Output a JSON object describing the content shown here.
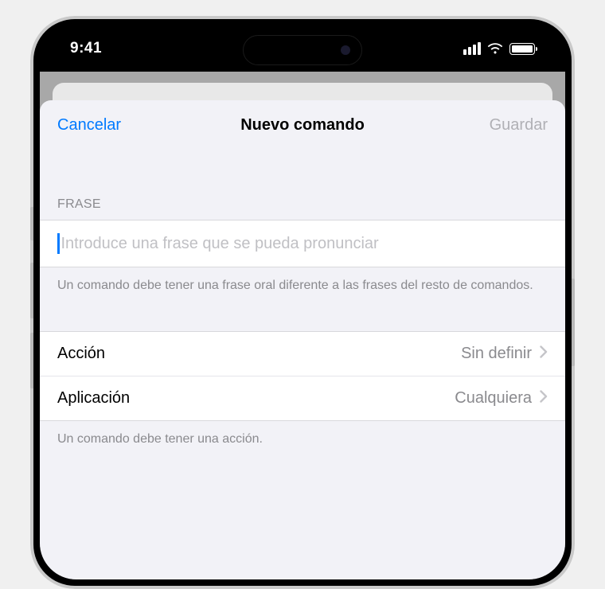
{
  "status": {
    "time": "9:41"
  },
  "nav": {
    "cancel": "Cancelar",
    "title": "Nuevo comando",
    "save": "Guardar"
  },
  "phrase": {
    "header": "FRASE",
    "placeholder": "Introduce una frase que se pueda pronunciar",
    "footer": "Un comando debe tener una frase oral diferente a las frases del resto de comandos."
  },
  "options": {
    "action_label": "Acción",
    "action_value": "Sin definir",
    "app_label": "Aplicación",
    "app_value": "Cualquiera",
    "footer": "Un comando debe tener una acción."
  },
  "colors": {
    "accent": "#007aff"
  }
}
